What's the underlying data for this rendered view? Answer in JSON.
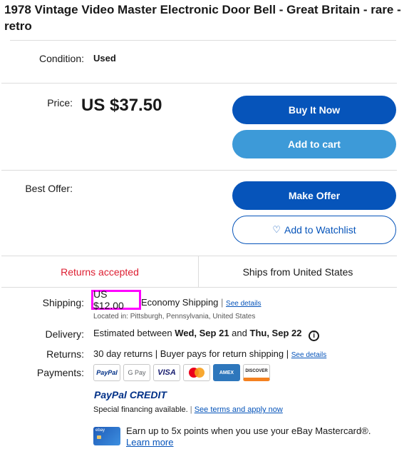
{
  "listing": {
    "title": "1978 Vintage Video Master Electronic Door Bell - Great Britain - rare - retro"
  },
  "condition": {
    "label": "Condition:",
    "value": "Used"
  },
  "price": {
    "label": "Price:",
    "value": "US $37.50"
  },
  "buttons": {
    "buy_now": "Buy It Now",
    "add_to_cart": "Add to cart",
    "make_offer": "Make Offer",
    "watchlist": "Add to Watchlist"
  },
  "best_offer": {
    "label": "Best Offer:"
  },
  "tabs": {
    "returns": "Returns accepted",
    "ships_from": "Ships from United States"
  },
  "shipping": {
    "label": "Shipping:",
    "price": "US $12.00",
    "method": "Economy Shipping",
    "see_details": "See details",
    "location": "Located in: Pittsburgh, Pennsylvania, United States"
  },
  "delivery": {
    "label": "Delivery:",
    "prefix": "Estimated between",
    "date_start": "Wed, Sep 21",
    "and": "and",
    "date_end": "Thu, Sep 22"
  },
  "returns": {
    "label": "Returns:",
    "text": "30 day returns | Buyer pays for return shipping |",
    "see_details": "See details"
  },
  "payments": {
    "label": "Payments:",
    "methods": [
      "PayPal",
      "G Pay",
      "VISA",
      "Mastercard",
      "AMEX",
      "DISCOVER"
    ]
  },
  "paypal_credit": {
    "logo": "PayPal CREDIT",
    "text": "Special financing available.",
    "link": "See terms and apply now"
  },
  "mastercard_promo": {
    "card_label": "ebay",
    "text": "Earn up to 5x points when you use your eBay Mastercard®.",
    "link": "Learn more"
  },
  "colors": {
    "primary": "#0654ba",
    "secondary": "#3d9ad8",
    "returns_red": "#dd1e31",
    "highlight": "#ff00ff"
  }
}
